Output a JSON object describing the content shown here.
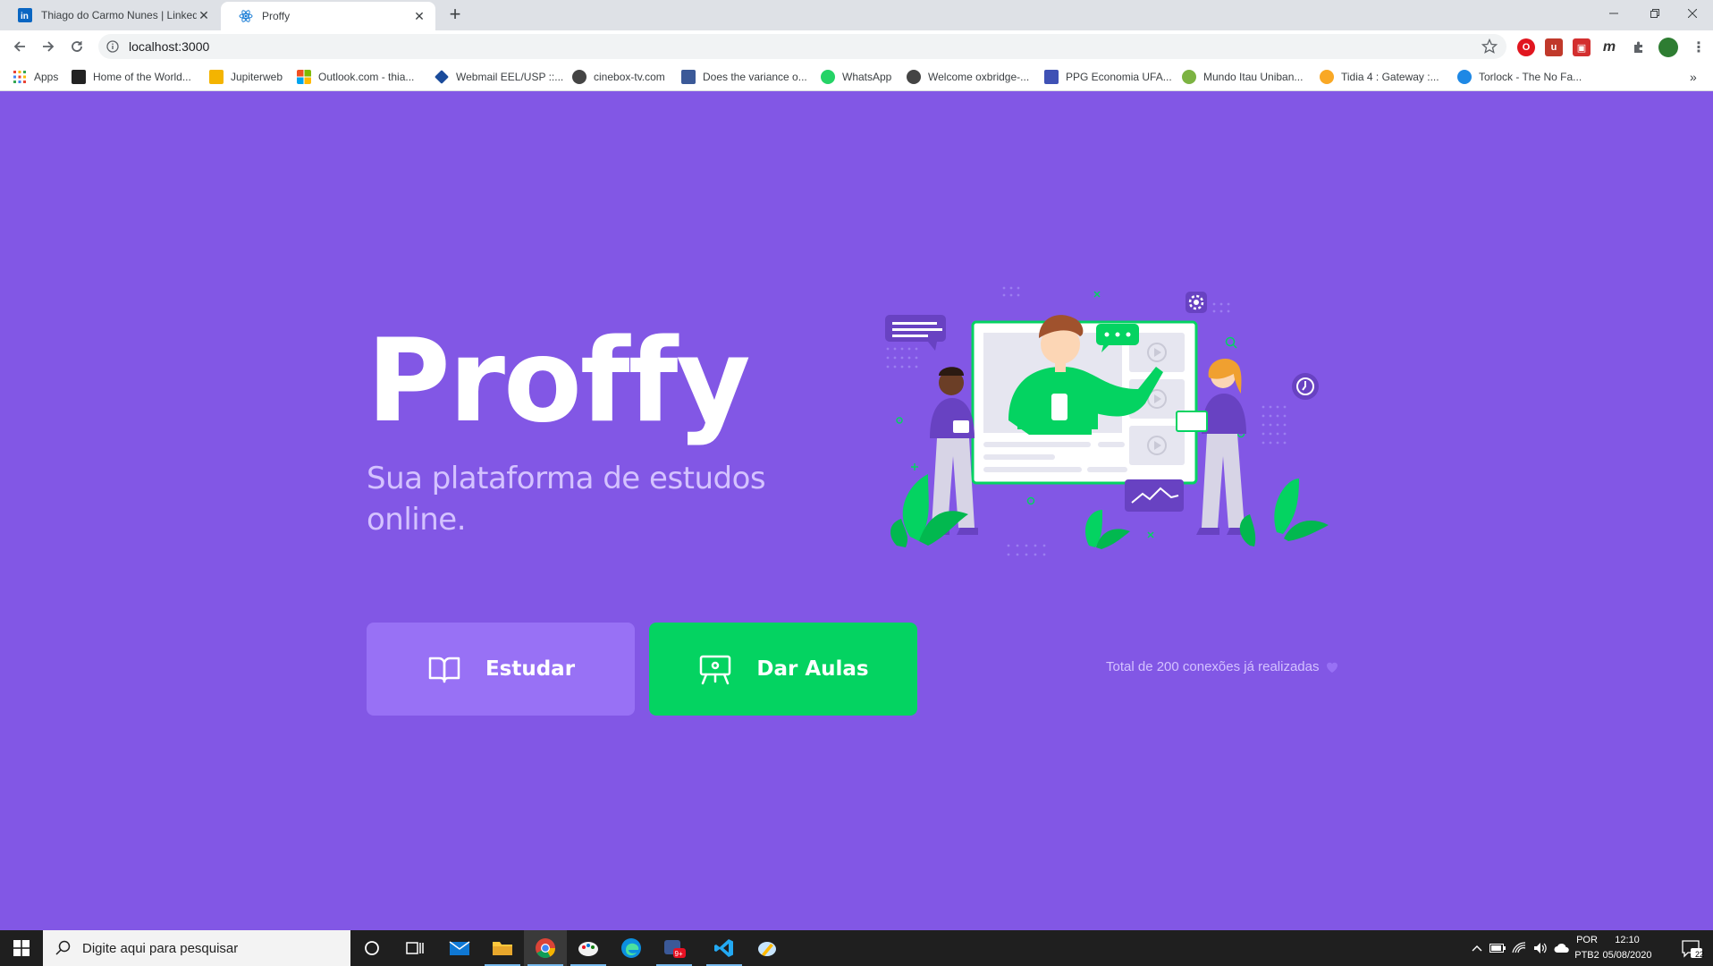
{
  "browser": {
    "tabs": [
      {
        "title": "Thiago do Carmo Nunes | Linkedl",
        "active": false
      },
      {
        "title": "Proffy",
        "active": true
      }
    ],
    "url": "localhost:3000",
    "bookmarks": [
      {
        "label": "Apps",
        "color": "#ea4335"
      },
      {
        "label": "Home of the World...",
        "color": "#222222"
      },
      {
        "label": "Jupiterweb",
        "color": "#f4b400"
      },
      {
        "label": "Outlook.com - thia...",
        "color": "#f25022"
      },
      {
        "label": "Webmail EEL/USP ::...",
        "color": "#1a4b9b"
      },
      {
        "label": "cinebox-tv.com",
        "color": "#444444"
      },
      {
        "label": "Does the variance o...",
        "color": "#3b5998"
      },
      {
        "label": "WhatsApp",
        "color": "#25d366"
      },
      {
        "label": "Welcome oxbridge-...",
        "color": "#444444"
      },
      {
        "label": "PPG Economia UFA...",
        "color": "#3f51b5"
      },
      {
        "label": "Mundo Itau Uniban...",
        "color": "#7cb342"
      },
      {
        "label": "Tidia 4 : Gateway :...",
        "color": "#f9a825"
      },
      {
        "label": "Torlock - The No Fa...",
        "color": "#1e88e5"
      }
    ]
  },
  "page": {
    "logo_text": "Proffy",
    "subtitle": "Sua plataforma de estudos online.",
    "buttons": {
      "study": "Estudar",
      "give_classes": "Dar Aulas"
    },
    "connections": "Total de 200 conexões já realizadas",
    "colors": {
      "background": "#8257e5",
      "study_button": "#9871f5",
      "give_button": "#04d361",
      "text_light": "#d4c2ff"
    }
  },
  "taskbar": {
    "search_placeholder": "Digite aqui para pesquisar",
    "language": "POR",
    "keyboard": "PTB2",
    "time": "12:10",
    "date": "05/08/2020",
    "notifications": "22"
  }
}
